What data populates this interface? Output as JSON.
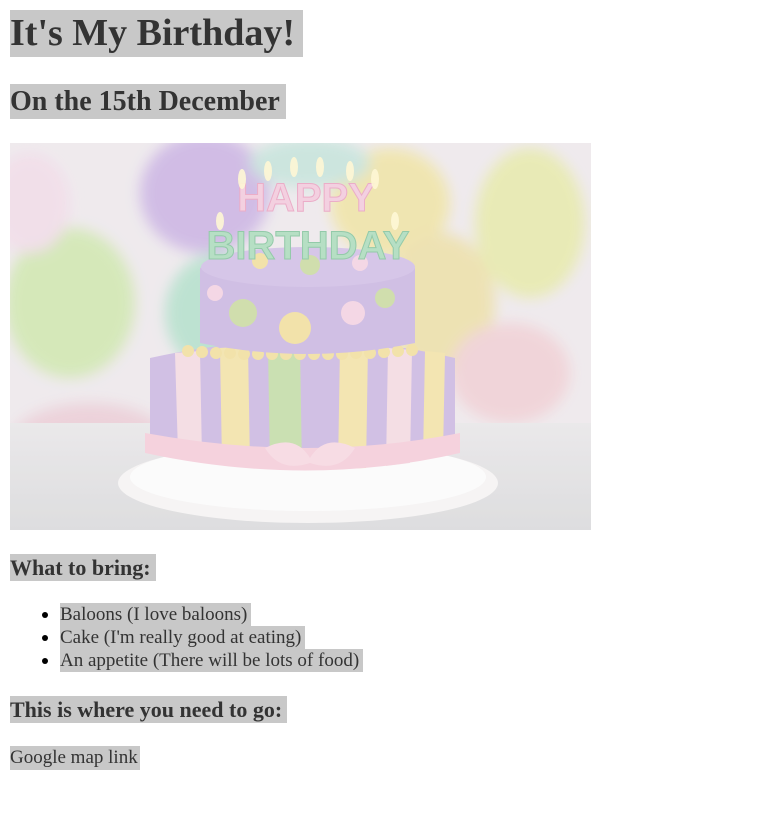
{
  "header": {
    "title": "It's My Birthday!",
    "subtitle": "On the 15th December"
  },
  "photo": {
    "candle_text_top": "HAPPY",
    "candle_text_bottom": "BIRTHDAY"
  },
  "bring": {
    "heading": "What to bring:",
    "items": [
      "Baloons (I love baloons)",
      "Cake (I'm really good at eating)",
      "An appetite (There will be lots of food)"
    ]
  },
  "location": {
    "heading": "This is where you need to go:",
    "link_text": "Google map link"
  },
  "colors": {
    "highlight": "#c8c8c8",
    "text": "#333333",
    "background": "#ffffff"
  }
}
